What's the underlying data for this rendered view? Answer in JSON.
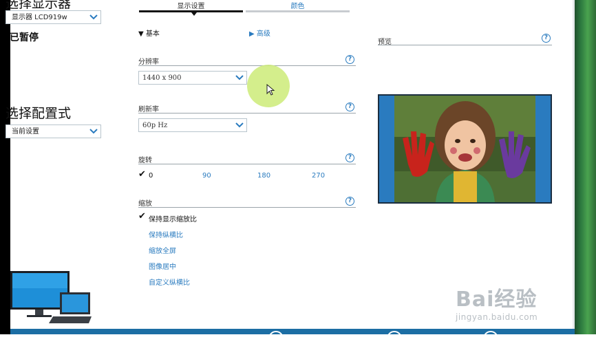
{
  "sidebar": {
    "monitor_title": "选择显示器",
    "monitor_select_value": "显示器 LCD919w",
    "status_text": "已暂停",
    "profile_title": "选择配置式",
    "profile_select_value": "当前设置"
  },
  "tabs": [
    {
      "label": "显示设置",
      "active": true
    },
    {
      "label": "颜色",
      "active": false
    }
  ],
  "toggles": {
    "basic_label": "基本",
    "advanced_label": "高级"
  },
  "resolution": {
    "label": "分辨率",
    "value": "1440 x 900"
  },
  "refresh": {
    "label": "刷新率",
    "value": "60p Hz"
  },
  "rotation": {
    "label": "旋转",
    "options": [
      "0",
      "90",
      "180",
      "270"
    ],
    "selected": "0"
  },
  "scaling": {
    "label": "缩放",
    "options": [
      "保持显示缩放比",
      "保持纵横比",
      "缩放全屏",
      "图像居中",
      "自定义纵横比"
    ],
    "selected": "保持显示缩放比"
  },
  "preview": {
    "label": "预览"
  },
  "help_glyph": "?",
  "watermark": {
    "main": "Bai经验",
    "sub": "jingyan.baidu.com"
  },
  "colors": {
    "accent": "#2a7bbf",
    "active_tab": "#111111",
    "inactive_tab": "#c8ccd0",
    "bottom_bar": "#1c6ea4"
  }
}
